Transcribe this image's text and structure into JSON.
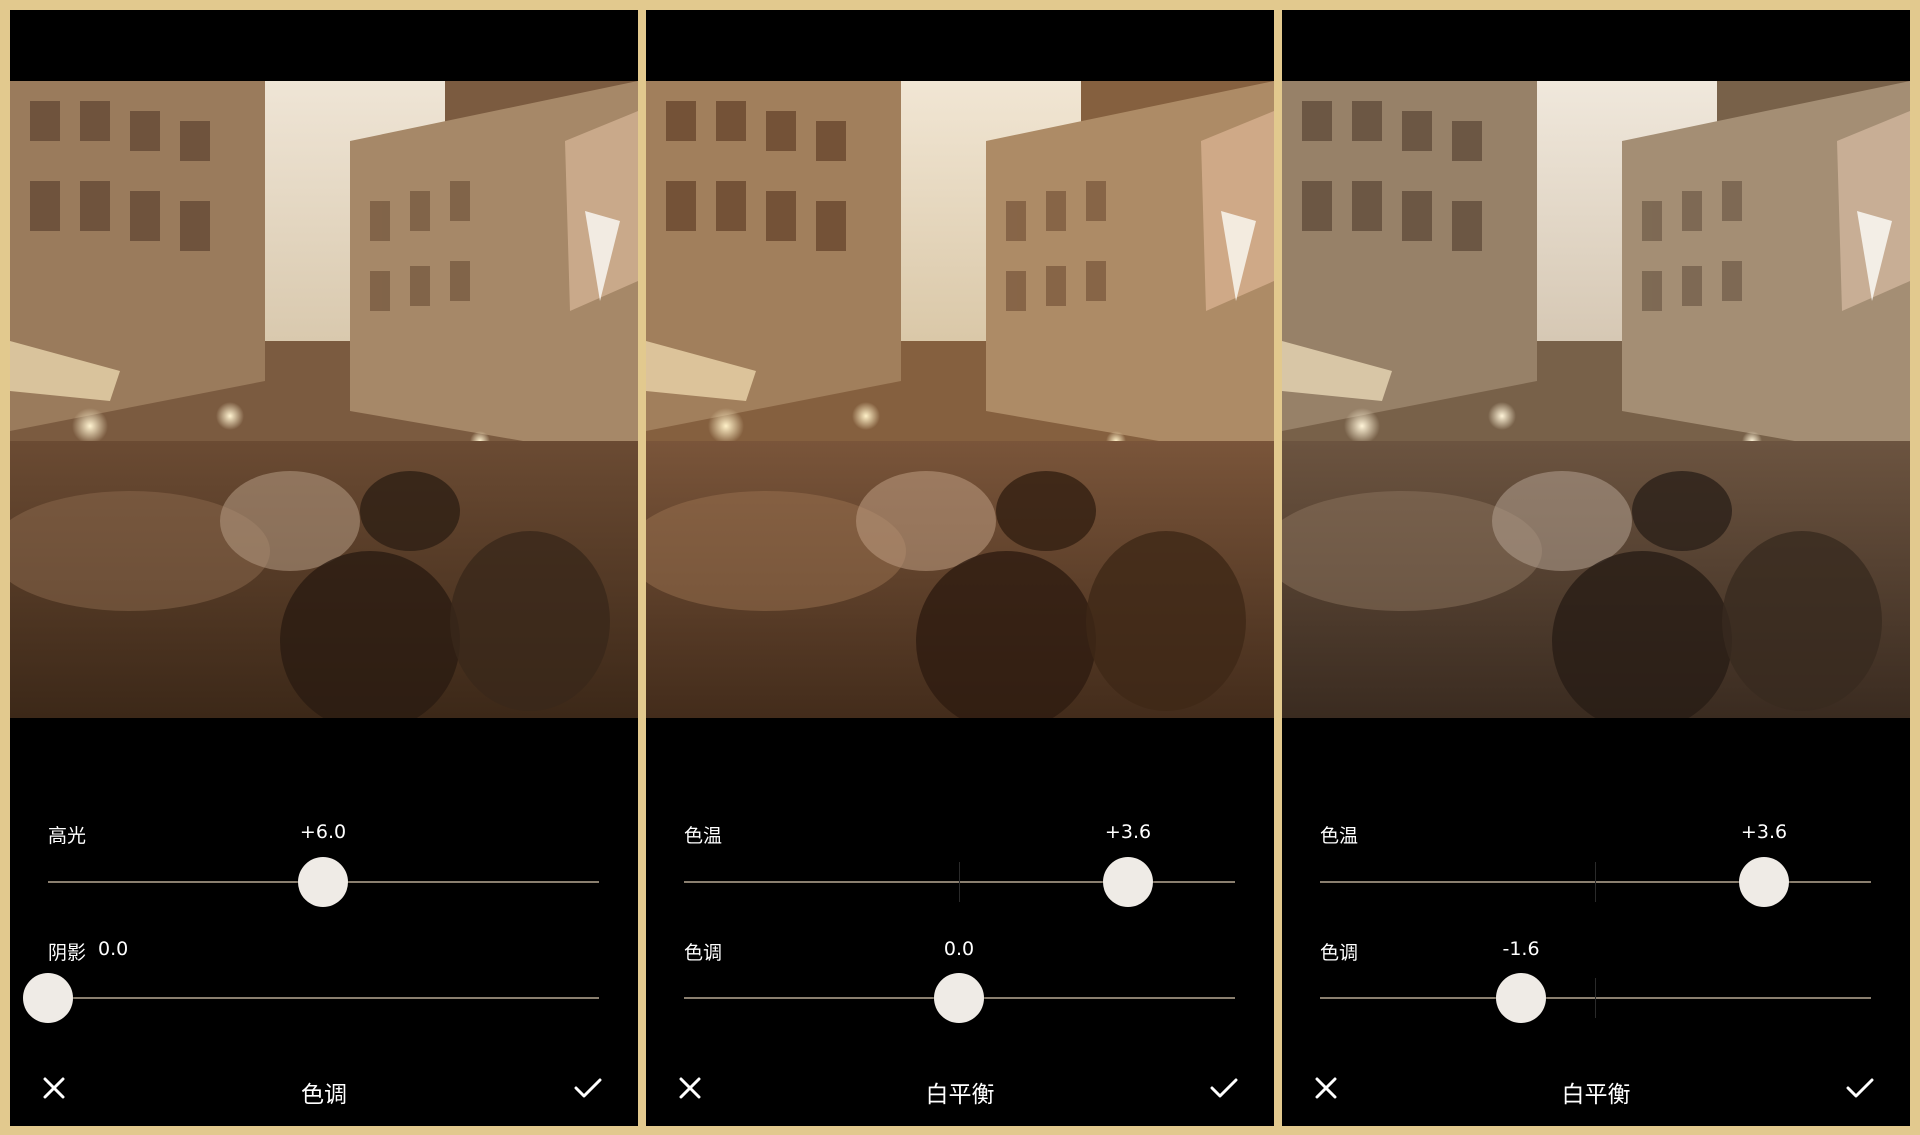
{
  "colors": {
    "frame_border": "#e2c98e",
    "panel_background": "#000000",
    "slider_track": "#8a7f6f",
    "slider_knob": "#efebe6"
  },
  "panels": [
    {
      "title": "色调",
      "cancel_icon": "close-icon",
      "confirm_icon": "checkmark-icon",
      "photo_description": "blurred crowded market street",
      "sliders": [
        {
          "label": "高光",
          "value": "+6.0",
          "fraction": 0.5
        },
        {
          "label": "阴影",
          "value": "0.0",
          "fraction": 0.0
        }
      ]
    },
    {
      "title": "白平衡",
      "cancel_icon": "close-icon",
      "confirm_icon": "checkmark-icon",
      "sliders": [
        {
          "label": "色温",
          "value": "+3.6",
          "fraction": 0.805
        },
        {
          "label": "色调",
          "value": "0.0",
          "fraction": 0.5
        }
      ]
    },
    {
      "title": "白平衡",
      "cancel_icon": "close-icon",
      "confirm_icon": "checkmark-icon",
      "sliders": [
        {
          "label": "色温",
          "value": "+3.6",
          "fraction": 0.805
        },
        {
          "label": "色调",
          "value": "-1.6",
          "fraction": 0.36
        }
      ]
    }
  ]
}
